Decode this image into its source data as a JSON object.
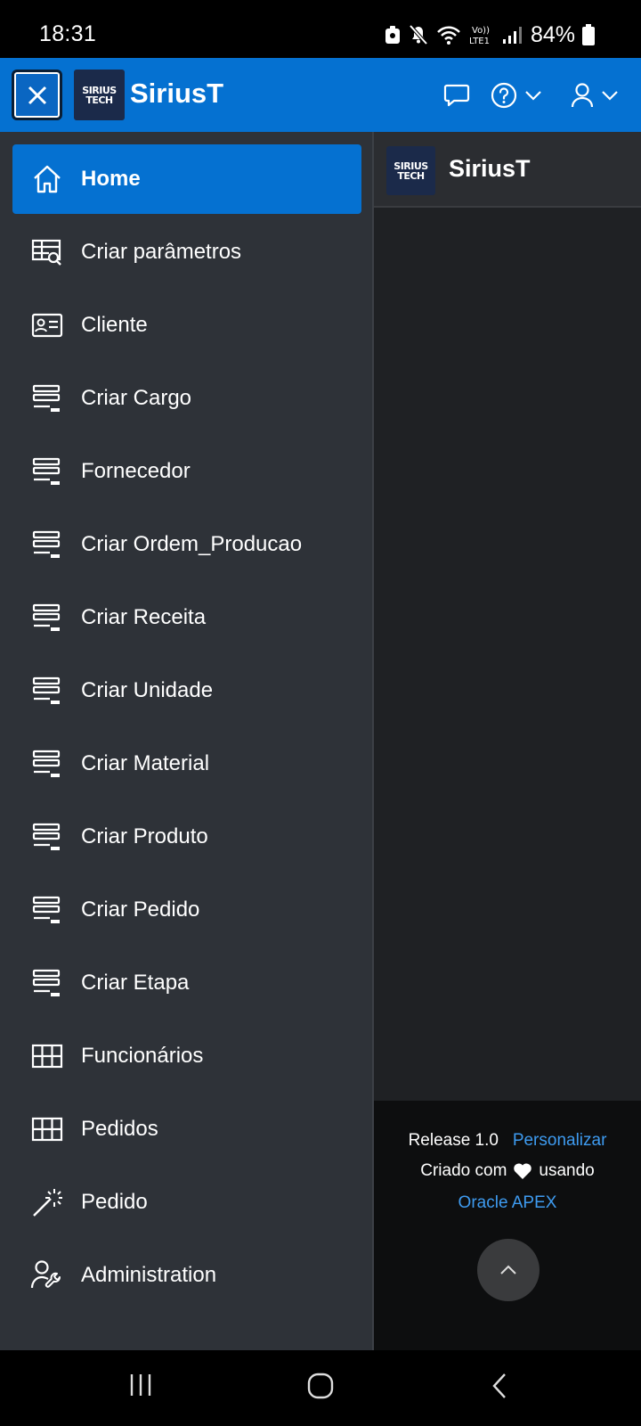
{
  "status_bar": {
    "time": "18:31",
    "battery": "84%",
    "network": "LTE1"
  },
  "header": {
    "close_label": "Close navigation",
    "logo_line1": "SIRIUS",
    "logo_line2": "TECH",
    "app_title": "SiriusT",
    "icons": [
      "chat-icon",
      "help-icon",
      "user-icon"
    ]
  },
  "sidebar": {
    "items": [
      {
        "label": "Home",
        "icon": "home-icon",
        "active": true
      },
      {
        "label": "Criar parâmetros",
        "icon": "table-search-icon",
        "active": false
      },
      {
        "label": "Cliente",
        "icon": "id-card-icon",
        "active": false
      },
      {
        "label": "Criar Cargo",
        "icon": "form-icon",
        "active": false
      },
      {
        "label": "Fornecedor",
        "icon": "form-icon",
        "active": false
      },
      {
        "label": "Criar Ordem_Producao",
        "icon": "form-icon",
        "active": false
      },
      {
        "label": "Criar Receita",
        "icon": "form-icon",
        "active": false
      },
      {
        "label": "Criar Unidade",
        "icon": "form-icon",
        "active": false
      },
      {
        "label": "Criar Material",
        "icon": "form-icon",
        "active": false
      },
      {
        "label": "Criar Produto",
        "icon": "form-icon",
        "active": false
      },
      {
        "label": "Criar Pedido",
        "icon": "form-icon",
        "active": false
      },
      {
        "label": "Criar Etapa",
        "icon": "form-icon",
        "active": false
      },
      {
        "label": "Funcionários",
        "icon": "grid-icon",
        "active": false
      },
      {
        "label": "Pedidos",
        "icon": "grid-icon",
        "active": false
      },
      {
        "label": "Pedido",
        "icon": "magic-wand-icon",
        "active": false
      },
      {
        "label": "Administration",
        "icon": "user-wrench-icon",
        "active": false
      }
    ]
  },
  "content": {
    "region_title": "SiriusT"
  },
  "footer": {
    "release": "Release 1.0",
    "customize": "Personalizar",
    "made_with": "Criado com",
    "using": "usando",
    "apex_link": "Oracle APEX"
  },
  "colors": {
    "accent": "#0571d1",
    "sidebar_bg": "#2e3238",
    "content_bg": "#1f2124",
    "link": "#3e9bf0"
  }
}
